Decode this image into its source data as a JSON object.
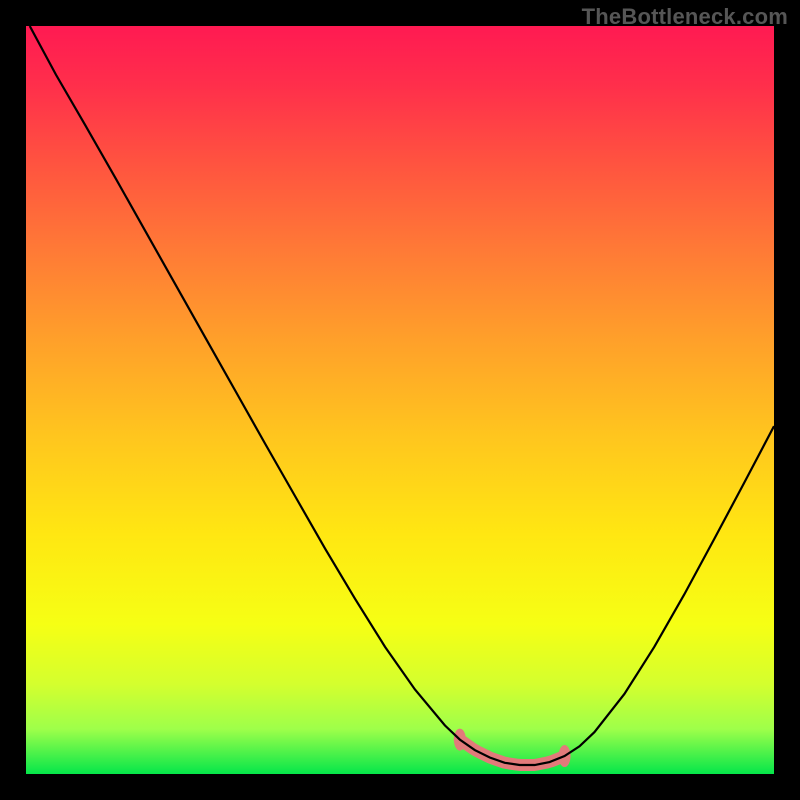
{
  "attribution": "TheBottleneck.com",
  "chart_data": {
    "type": "line",
    "title": "",
    "xlabel": "",
    "ylabel": "",
    "xlim": [
      0,
      100
    ],
    "ylim": [
      0,
      100
    ],
    "background_gradient": {
      "stops": [
        {
          "offset": 0.0,
          "color": "#ff1a52"
        },
        {
          "offset": 0.08,
          "color": "#ff2f4b"
        },
        {
          "offset": 0.18,
          "color": "#ff5240"
        },
        {
          "offset": 0.3,
          "color": "#ff7a36"
        },
        {
          "offset": 0.42,
          "color": "#ffa02a"
        },
        {
          "offset": 0.55,
          "color": "#ffc61e"
        },
        {
          "offset": 0.68,
          "color": "#ffe712"
        },
        {
          "offset": 0.8,
          "color": "#f6ff14"
        },
        {
          "offset": 0.88,
          "color": "#d4ff2e"
        },
        {
          "offset": 0.94,
          "color": "#9eff4a"
        },
        {
          "offset": 1.0,
          "color": "#05e64a"
        }
      ]
    },
    "series": [
      {
        "name": "bottleneck-curve",
        "color": "#000000",
        "width": 2.2,
        "x": [
          0.5,
          4,
          8,
          12,
          16,
          20,
          24,
          28,
          32,
          36,
          40,
          44,
          48,
          52,
          56,
          58,
          60,
          62,
          64,
          66,
          68,
          70,
          72,
          74,
          76,
          80,
          84,
          88,
          92,
          96,
          100
        ],
        "y": [
          100,
          93.5,
          86.6,
          79.6,
          72.5,
          65.4,
          58.3,
          51.2,
          44.1,
          37.1,
          30.1,
          23.4,
          17.0,
          11.3,
          6.5,
          4.6,
          3.2,
          2.2,
          1.5,
          1.2,
          1.2,
          1.6,
          2.4,
          3.7,
          5.6,
          10.7,
          17.0,
          24.0,
          31.4,
          38.9,
          46.5
        ]
      }
    ],
    "overlay_band": {
      "name": "optimal-range-marker",
      "color": "#e27a7a",
      "x_start": 58,
      "x_end": 72,
      "thickness": 12,
      "end_cap_height": 22
    }
  }
}
